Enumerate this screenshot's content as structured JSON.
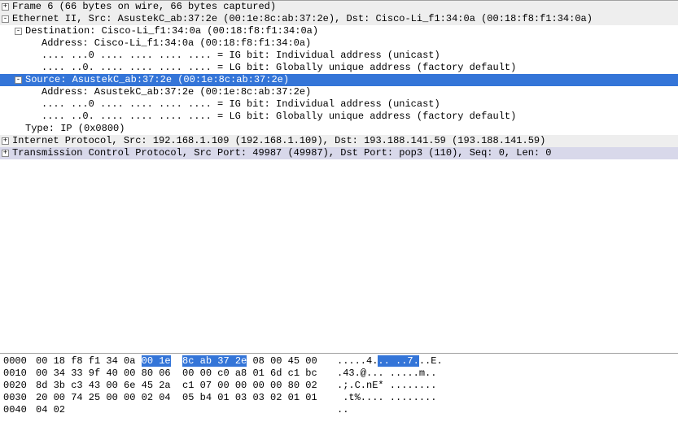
{
  "details": {
    "frame_summary": "Frame 6 (66 bytes on wire, 66 bytes captured)",
    "ethernet_summary": "Ethernet II, Src: AsustekC_ab:37:2e (00:1e:8c:ab:37:2e), Dst: Cisco-Li_f1:34:0a (00:18:f8:f1:34:0a)",
    "destination_summary": "Destination: Cisco-Li_f1:34:0a (00:18:f8:f1:34:0a)",
    "dest_address": "Address: Cisco-Li_f1:34:0a (00:18:f8:f1:34:0a)",
    "dest_ig_bit": ".... ...0 .... .... .... .... = IG bit: Individual address (unicast)",
    "dest_lg_bit": ".... ..0. .... .... .... .... = LG bit: Globally unique address (factory default)",
    "source_summary": "Source: AsustekC_ab:37:2e (00:1e:8c:ab:37:2e)",
    "src_address": "Address: AsustekC_ab:37:2e (00:1e:8c:ab:37:2e)",
    "src_ig_bit": ".... ...0 .... .... .... .... = IG bit: Individual address (unicast)",
    "src_lg_bit": ".... ..0. .... .... .... .... = LG bit: Globally unique address (factory default)",
    "type": "Type: IP (0x0800)",
    "ip_summary": "Internet Protocol, Src: 192.168.1.109 (192.168.1.109), Dst: 193.188.141.59 (193.188.141.59)",
    "tcp_summary": "Transmission Control Protocol, Src Port: 49987 (49987), Dst Port: pop3 (110), Seq: 0, Len: 0"
  },
  "toggles": {
    "plus": "+",
    "minus": "-"
  },
  "hex": {
    "rows": [
      {
        "offset": "0000",
        "b1": "00 18 f8 f1 34 0a ",
        "b_hl1": "00 1e",
        "b_mid": "  ",
        "b_hl2": "8c ab 37 2e",
        "b2": " 08 00 45 00",
        "a1": ".....4.",
        "a_hl1": ".. ..7.",
        "a2": "..E.",
        "plain_bytes": "",
        "plain_ascii": ""
      },
      {
        "offset": "0010",
        "plain_bytes": "00 34 33 9f 40 00 80 06  00 00 c0 a8 01 6d c1 bc",
        "plain_ascii": ".43.@... .....m.."
      },
      {
        "offset": "0020",
        "plain_bytes": "8d 3b c3 43 00 6e 45 2a  c1 07 00 00 00 00 80 02",
        "plain_ascii": ".;.C.nE* ........"
      },
      {
        "offset": "0030",
        "plain_bytes": "20 00 74 25 00 00 02 04  05 b4 01 03 03 02 01 01",
        "plain_ascii": " .t%.... ........"
      },
      {
        "offset": "0040",
        "plain_bytes": "04 02",
        "plain_ascii": ".."
      }
    ]
  }
}
